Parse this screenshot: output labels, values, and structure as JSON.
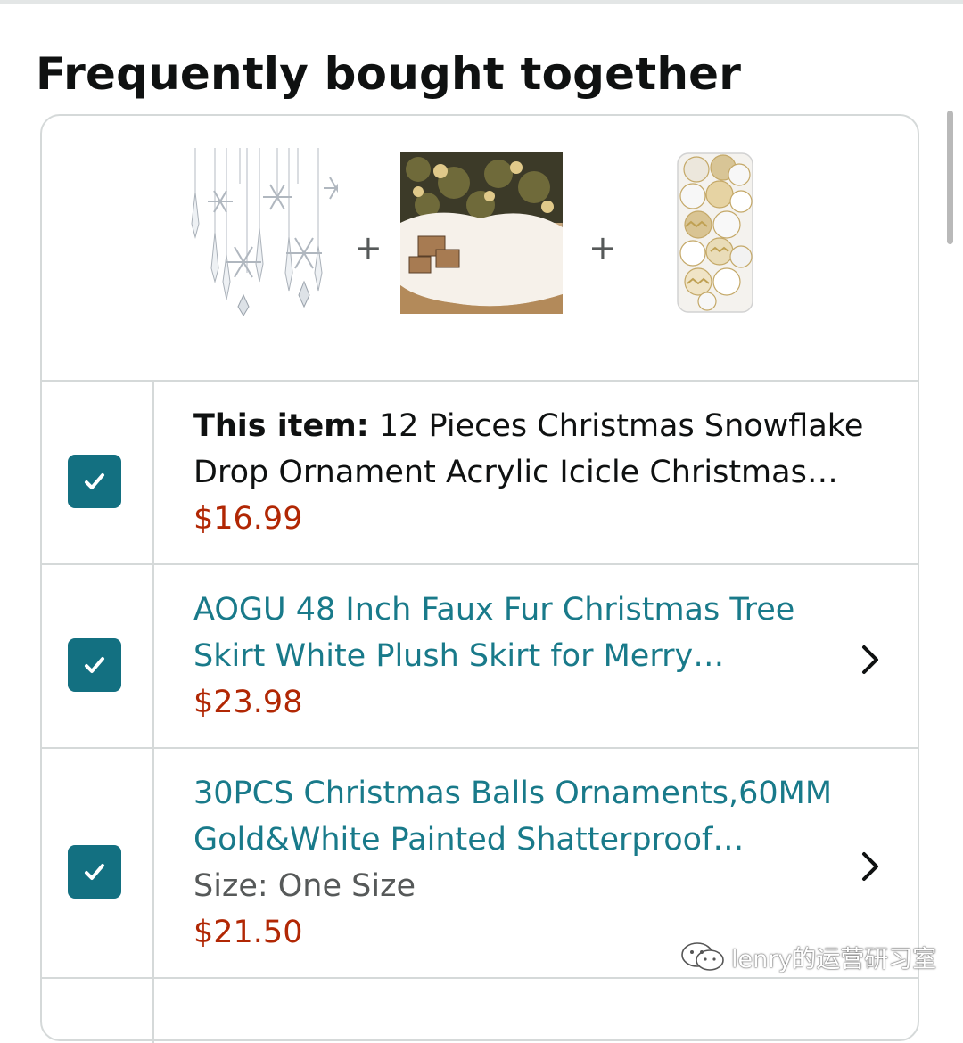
{
  "section": {
    "title": "Frequently bought together"
  },
  "bundle": {
    "plus_symbol": "+",
    "images": [
      {
        "name": "snowflake-ornaments",
        "icon": "snowflake-icicle-image"
      },
      {
        "name": "tree-skirt",
        "icon": "tree-skirt-image"
      },
      {
        "name": "christmas-balls",
        "icon": "ornament-balls-image"
      }
    ]
  },
  "items": [
    {
      "checked": true,
      "label": "This item:",
      "name_line1": " 12 Pieces Christmas Snowflake",
      "name_line2": "Drop Ornament Acrylic Icicle Christmas…",
      "price": "$16.99"
    },
    {
      "checked": true,
      "name_line1": "AOGU 48 Inch Faux Fur Christmas Tree",
      "name_line2": "Skirt White Plush Skirt for Merry…",
      "price": "$23.98"
    },
    {
      "checked": true,
      "name_line1": "30PCS Christmas Balls Ornaments,60MM",
      "name_line2": "Gold&White Painted Shatterproof…",
      "size": "Size: One Size",
      "price": "$21.50"
    }
  ],
  "watermark": {
    "text": "lenry的运营研习室"
  },
  "colors": {
    "checkbox": "#137081",
    "link": "#197a8a",
    "price": "#b12704",
    "border": "#d5d9d9"
  }
}
